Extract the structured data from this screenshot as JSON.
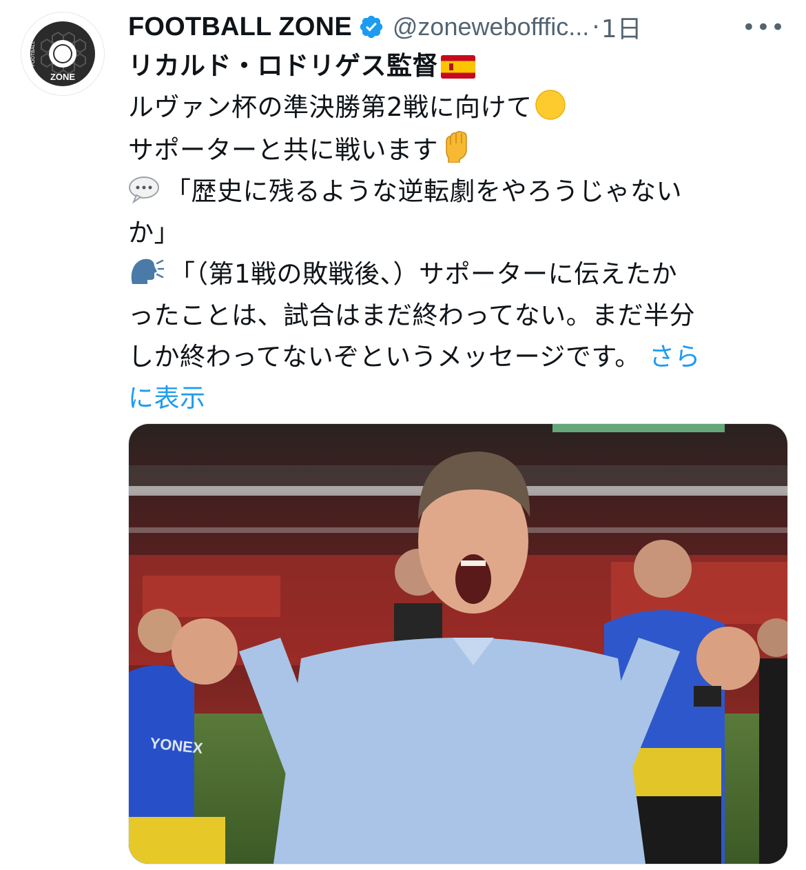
{
  "tweet": {
    "author": {
      "display_name": "FOOTBALL ZONE",
      "handle": "@zonewebofficial",
      "handle_display": "@zonewebofffic...",
      "verified": true,
      "avatar_logo_top": "FOOTBALL",
      "avatar_logo_bottom": "ZONE"
    },
    "separator": "·",
    "time": "1日",
    "more_label": "•••",
    "text": {
      "line1": "リカルド・ロドリゲス監督",
      "line2": "ルヴァン杯の準決勝第2戦に向けて",
      "line3": "サポーターと共に戦います",
      "line4": "「歴史に残るような逆転劇をやろうじゃない",
      "line5": "か」",
      "line6": "「（第1戦の敗戦後、）サポーターに伝えたか",
      "line7": "ったことは、試合はまだ終わってない。まだ半分",
      "line8": "しか終わってないぞというメッセージです。",
      "show_more_1": "さら",
      "show_more_2": "に表示"
    },
    "emojis": {
      "line1": "spain-flag-icon",
      "line2": "yellow-circle-icon",
      "line3": "raised-fist-icon",
      "line4": "speech-balloon-icon",
      "line6": "speaking-head-icon"
    },
    "colors": {
      "text": "#0f1419",
      "secondary": "#536471",
      "link": "#1d9bf0",
      "verified": "#1d9bf0"
    }
  },
  "media": {
    "type": "photo",
    "jersey_text": "YONEX"
  }
}
